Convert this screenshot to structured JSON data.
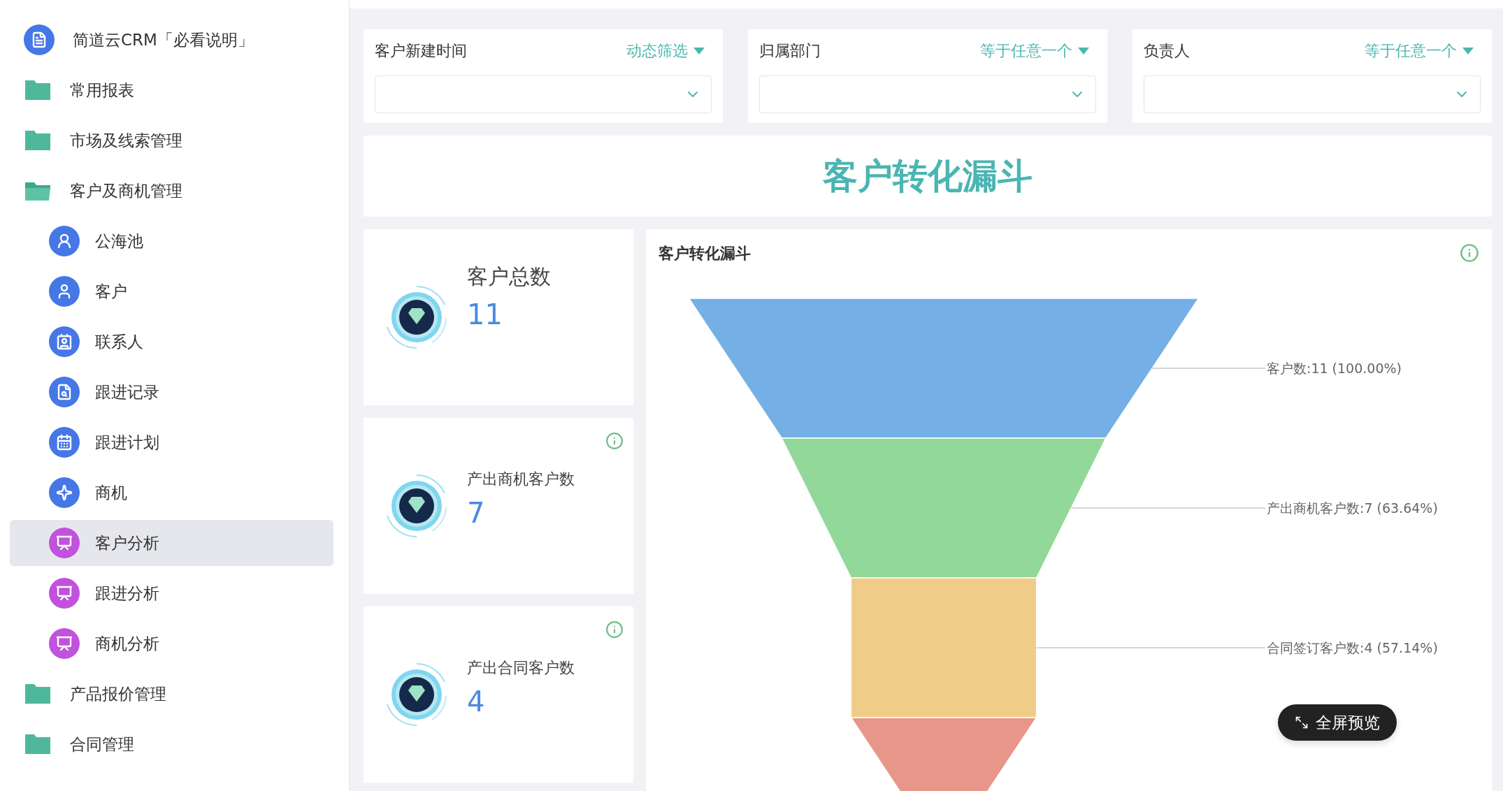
{
  "sidebar": {
    "items": [
      {
        "kind": "doc",
        "label": "简道云CRM「必看说明」",
        "selected": false
      },
      {
        "kind": "folder",
        "label": "常用报表",
        "expanded": false,
        "selected": false
      },
      {
        "kind": "folder",
        "label": "市场及线索管理",
        "expanded": false,
        "selected": false
      },
      {
        "kind": "folder",
        "label": "客户及商机管理",
        "expanded": true,
        "selected": false,
        "children": [
          {
            "kind": "pool",
            "label": "公海池",
            "selected": false
          },
          {
            "kind": "person",
            "label": "客户",
            "selected": false
          },
          {
            "kind": "contact",
            "label": "联系人",
            "selected": false
          },
          {
            "kind": "record",
            "label": "跟进记录",
            "selected": false
          },
          {
            "kind": "plan",
            "label": "跟进计划",
            "selected": false
          },
          {
            "kind": "deal",
            "label": "商机",
            "selected": false
          },
          {
            "kind": "report",
            "label": "客户分析",
            "selected": true
          },
          {
            "kind": "report",
            "label": "跟进分析",
            "selected": false
          },
          {
            "kind": "report",
            "label": "商机分析",
            "selected": false
          }
        ]
      },
      {
        "kind": "folder",
        "label": "产品报价管理",
        "expanded": false,
        "selected": false
      },
      {
        "kind": "folder",
        "label": "合同管理",
        "expanded": false,
        "selected": false
      }
    ]
  },
  "filters": [
    {
      "label": "客户新建时间",
      "mode": "动态筛选"
    },
    {
      "label": "归属部门",
      "mode": "等于任意一个"
    },
    {
      "label": "负责人",
      "mode": "等于任意一个"
    }
  ],
  "title": "客户转化漏斗",
  "stats": [
    {
      "label": "客户总数",
      "value": "11",
      "large": true,
      "info": false
    },
    {
      "label": "产出商机客户数",
      "value": "7",
      "large": false,
      "info": true
    },
    {
      "label": "产出合同客户数",
      "value": "4",
      "large": false,
      "info": true
    }
  ],
  "funnel": {
    "title": "客户转化漏斗",
    "info": true,
    "stages": [
      {
        "label": "客户数:11 (100.00%)",
        "color": "#74b0e6"
      },
      {
        "label": "产出商机客户数:7 (63.64%)",
        "color": "#92d899"
      },
      {
        "label": "合同签订客户数:4 (57.14%)",
        "color": "#f0cc89"
      },
      {
        "color": "#e8968a"
      }
    ]
  },
  "fullscreen_button": "全屏预览"
}
